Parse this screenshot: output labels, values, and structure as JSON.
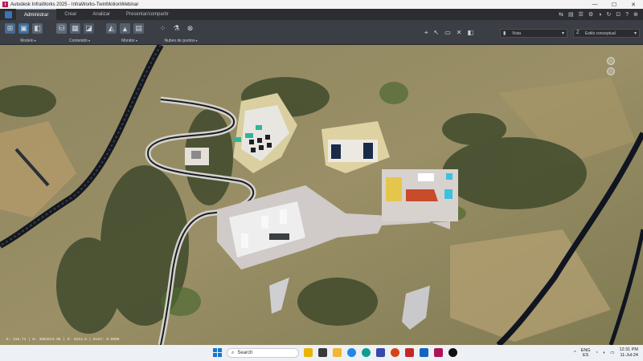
{
  "titlebar": {
    "logo": "I",
    "title": "Autodesk InfraWorks 2025 - InfraWorks-TwinMotionWebinar"
  },
  "window_controls": {
    "minimize": "—",
    "maximize": "☐",
    "close": "✕"
  },
  "tabs": [
    {
      "label": "Administrar",
      "active": true
    },
    {
      "label": "Crear",
      "active": false
    },
    {
      "label": "Analizar",
      "active": false
    },
    {
      "label": "Presentar/compartir",
      "active": false
    }
  ],
  "tab_icons": [
    "⇆",
    "▤",
    "☰",
    "⚙",
    "◑",
    "↻",
    "⊡",
    "?",
    "⊕"
  ],
  "ribbon": {
    "groups": [
      {
        "label": "Modelo",
        "icons": [
          "⊞",
          "▣",
          "◧"
        ]
      },
      {
        "label": "Contenido",
        "icons": [
          "⛁",
          "▦",
          "◪"
        ]
      },
      {
        "label": "Monitor",
        "icons": [
          "◭",
          "▲",
          "▤"
        ]
      },
      {
        "label": "Nubes de puntos",
        "icons": [
          "⁘",
          "⚗",
          "⊗"
        ]
      }
    ],
    "tools": [
      "⌖",
      "↖",
      "▭",
      "✕",
      "◧"
    ],
    "view_dropdown": {
      "icon": "▮",
      "value": "Vista"
    },
    "style_dropdown": {
      "icon": "Z",
      "value": "Estilo conceptual"
    }
  },
  "viewport": {
    "coords": "E: 315.71 | N: 4681613.96 | Z: 2211.5 | ELEV: 0.9896"
  },
  "taskbar": {
    "search_placeholder": "Search",
    "search_icon": "⌕",
    "apps": [
      {
        "name": "file-explorer",
        "color": "#e8b400"
      },
      {
        "name": "media",
        "color": "#3a3a3a"
      },
      {
        "name": "folder",
        "color": "#f2b632"
      },
      {
        "name": "chrome",
        "color": "#1e88e5"
      },
      {
        "name": "edge",
        "color": "#0f9d8f"
      },
      {
        "name": "teams",
        "color": "#3949ab"
      },
      {
        "name": "powerpoint",
        "color": "#d84315"
      },
      {
        "name": "office",
        "color": "#c62828"
      },
      {
        "name": "word",
        "color": "#1565c0"
      },
      {
        "name": "infraworks",
        "color": "#ad1457"
      },
      {
        "name": "twinmotion",
        "color": "#111111"
      }
    ],
    "tray_chevron": "^",
    "lang_top": "ENG",
    "lang_bottom": "ES",
    "wifi_icon": "◔",
    "volume_icon": "◖",
    "battery_icon": "▭",
    "time": "12:31 PM",
    "date": "11-Jul-24"
  }
}
